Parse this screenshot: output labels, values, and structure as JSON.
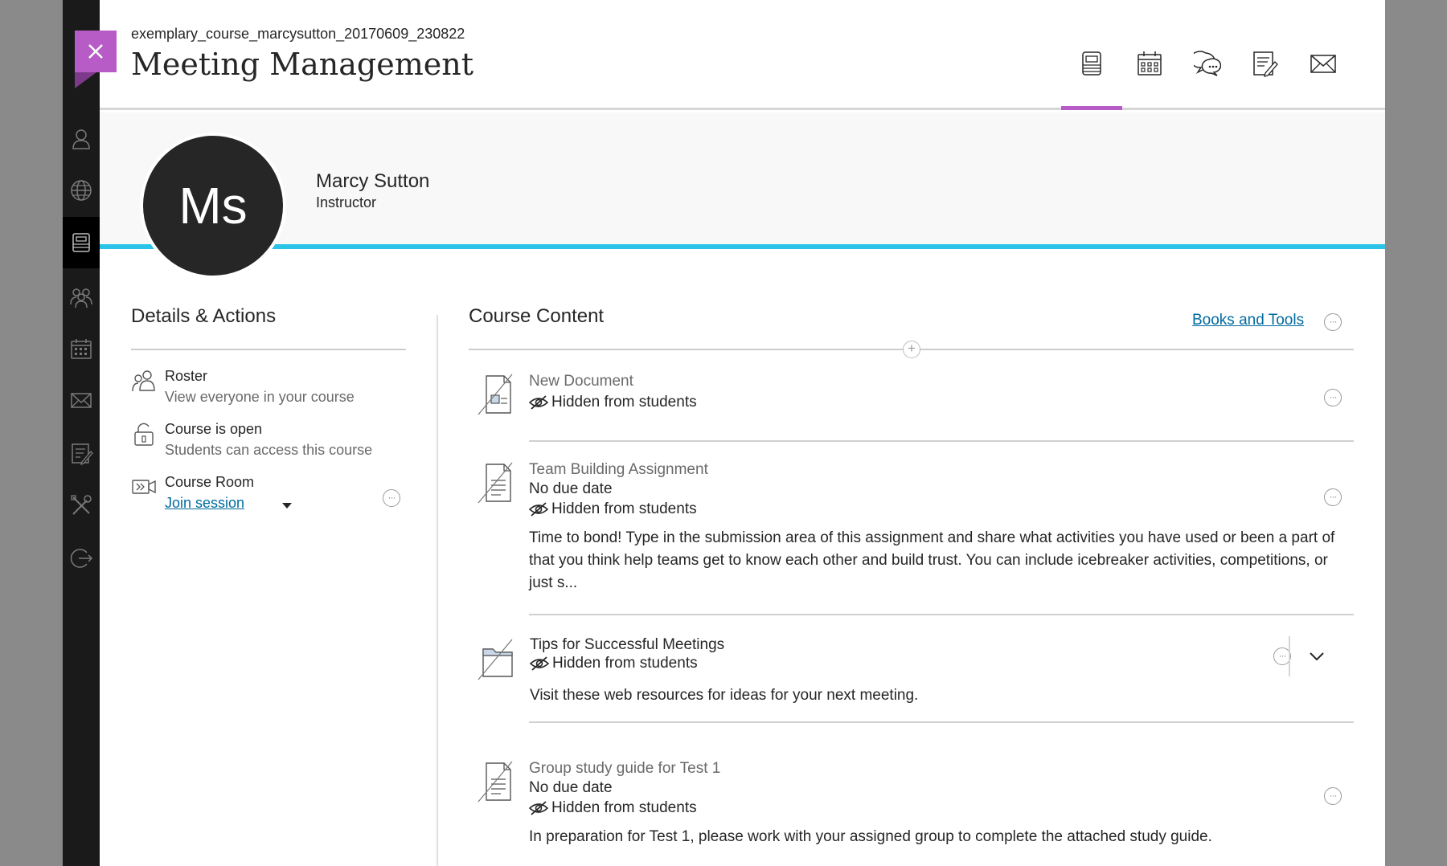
{
  "header": {
    "course_id": "exemplary_course_marcysutton_20170609_230822",
    "course_title": "Meeting Management",
    "icons": [
      "content-icon",
      "calendar-icon",
      "discussions-icon",
      "gradebook-icon",
      "messages-icon"
    ],
    "active_icon": "content-icon"
  },
  "close": {
    "icon": "close-icon"
  },
  "nav_rail": {
    "items": [
      "profile-icon",
      "globe-icon",
      "courses-icon",
      "groups-icon",
      "calendar-icon",
      "messages-icon",
      "grades-icon",
      "tools-icon",
      "sign-out-icon"
    ],
    "active": "courses-icon"
  },
  "instructor": {
    "initials": "Ms",
    "name": "Marcy Sutton",
    "role": "Instructor"
  },
  "details": {
    "title": "Details & Actions",
    "roster_title": "Roster",
    "roster_sub": "View everyone in your course",
    "open_title": "Course is open",
    "open_sub": "Students can access this course",
    "room_title": "Course Room",
    "room_link": "Join session"
  },
  "content": {
    "title": "Course Content",
    "books_link": "Books and Tools",
    "items": [
      {
        "title": "New Document",
        "hidden": "Hidden from students"
      },
      {
        "title": "Team Building Assignment",
        "due": "No due date",
        "hidden": "Hidden from students",
        "description": "Time to bond! Type in the submission area of this assignment and share what activities you have used or been a part of that you think help teams get to know each other and build trust. You can include icebreaker activities, competitions, or just s..."
      },
      {
        "title": "Tips for Successful Meetings",
        "hidden": "Hidden from students",
        "description": "Visit these web resources for ideas for your next meeting."
      },
      {
        "title": "Group study guide for Test 1",
        "due": "No due date",
        "hidden": "Hidden from students",
        "description": "In preparation for Test 1, please work with your assigned group to complete the attached study guide."
      }
    ]
  },
  "help": {
    "label": "?"
  },
  "colors": {
    "accent_purple": "#b75cc6",
    "accent_cyan": "#2bc4e8",
    "link_blue": "#006b9f",
    "rail_dark": "#1a1a1a"
  }
}
